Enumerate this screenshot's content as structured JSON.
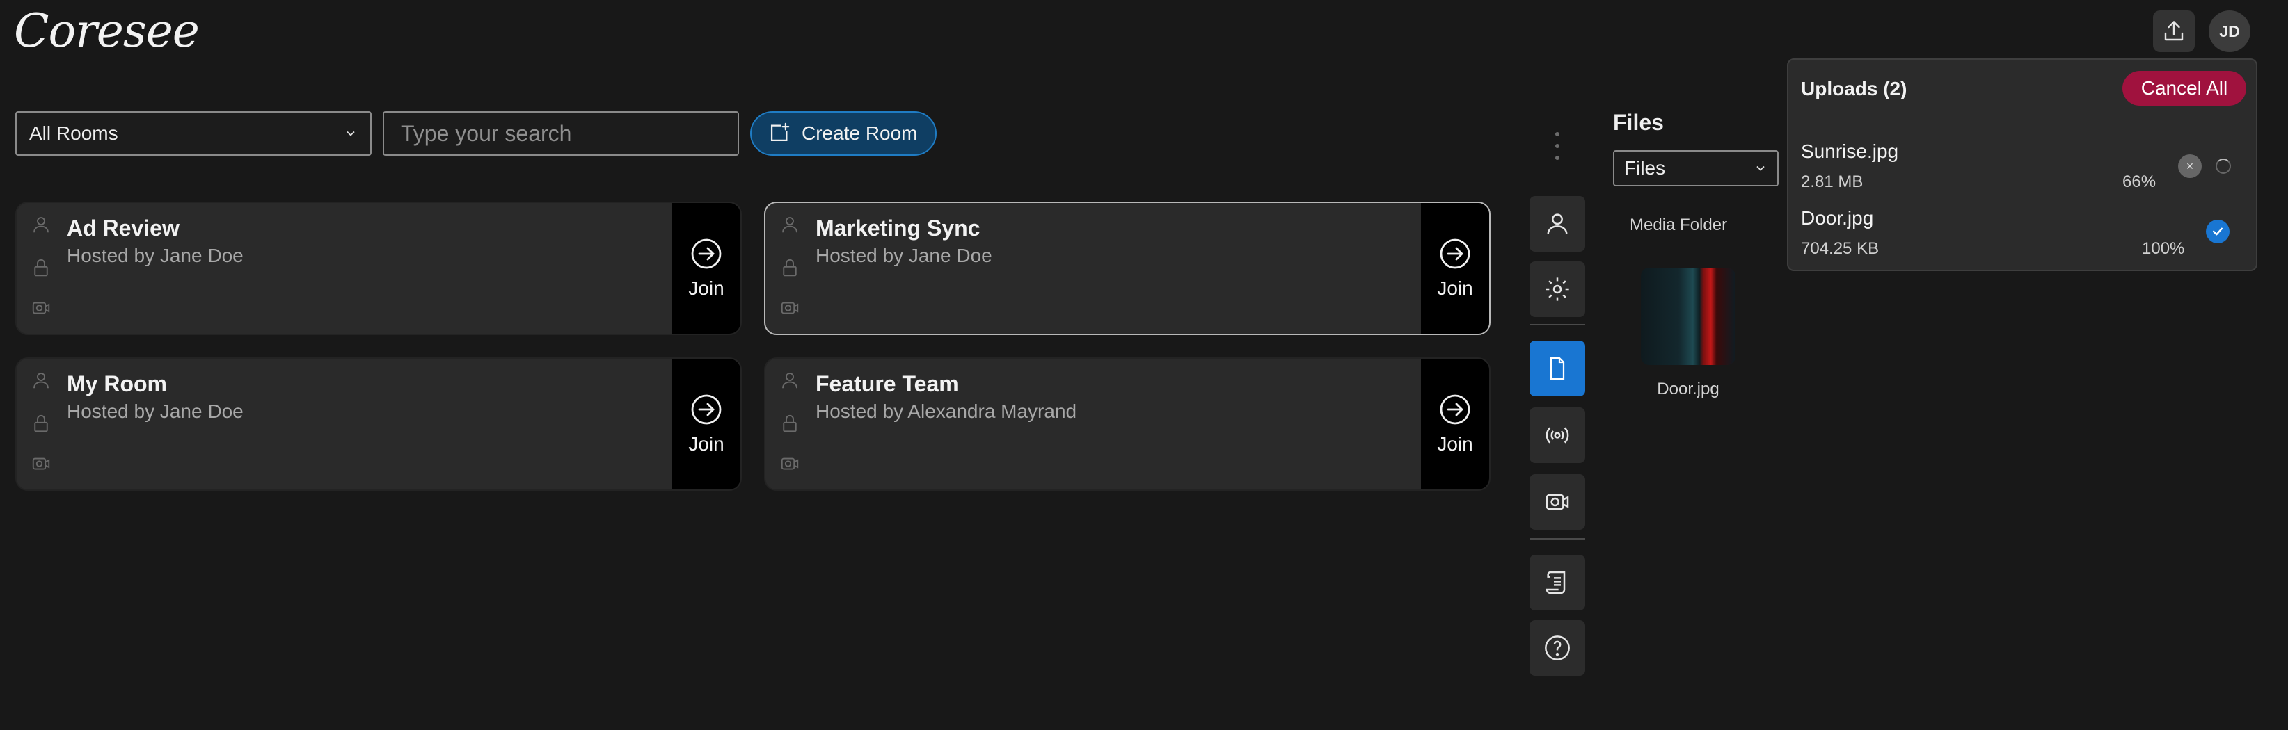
{
  "app": {
    "logo_text": "Coresee"
  },
  "header": {
    "user_initials": "JD"
  },
  "toolbar": {
    "rooms_select_value": "All Rooms",
    "search_placeholder": "Type your search",
    "create_room_label": "Create Room"
  },
  "rooms": [
    {
      "title": "Ad Review",
      "host": "Hosted by Jane Doe",
      "join_label": "Join"
    },
    {
      "title": "Marketing Sync",
      "host": "Hosted by Jane Doe",
      "join_label": "Join"
    },
    {
      "title": "My Room",
      "host": "Hosted by Jane Doe",
      "join_label": "Join"
    },
    {
      "title": "Feature Team",
      "host": "Hosted by Alexandra Mayrand",
      "join_label": "Join"
    }
  ],
  "files_panel": {
    "title": "Files",
    "select_value": "Files",
    "folder_label": "Media Folder",
    "items": [
      {
        "name": "Door.jpg"
      }
    ]
  },
  "uploads": {
    "title": "Uploads (2)",
    "cancel_all_label": "Cancel All",
    "items": [
      {
        "name": "Sunrise.jpg",
        "size": "2.81 MB",
        "percent": "66%",
        "status": "in-progress"
      },
      {
        "name": "Door.jpg",
        "size": "704.25 KB",
        "percent": "100%",
        "status": "complete"
      }
    ]
  },
  "colors": {
    "background": "#181818",
    "card": "#2a2a2a",
    "accent": "#1976d2",
    "create_button": "#0f3e63",
    "cancel_all": "#a0123e"
  }
}
